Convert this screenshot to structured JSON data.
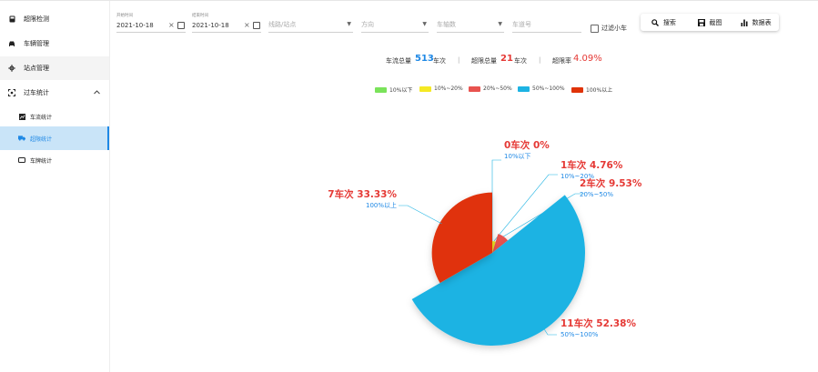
{
  "sidebar": {
    "items": [
      {
        "label": "超限检测",
        "icon": "device-icon"
      },
      {
        "label": "车辆管理",
        "icon": "car-icon"
      },
      {
        "label": "站点管理",
        "icon": "station-icon"
      },
      {
        "label": "过车统计",
        "icon": "stats-icon"
      }
    ],
    "subitems": [
      {
        "label": "车流统计",
        "icon": "flow-chart-icon"
      },
      {
        "label": "超限统计",
        "icon": "truck-icon"
      },
      {
        "label": "车牌统计",
        "icon": "plate-icon"
      }
    ]
  },
  "filters": {
    "start": {
      "label": "开始时间",
      "value": "2021-10-18"
    },
    "end": {
      "label": "结束时间",
      "value": "2021-10-18"
    },
    "route_placeholder": "线路/站点",
    "direction_placeholder": "方向",
    "axles_placeholder": "车轴数",
    "lane_placeholder": "车道号",
    "filter_small_label": "过滤小车"
  },
  "toolbar": {
    "search_label": "搜索",
    "screenshot_label": "截图",
    "datatable_label": "数据表"
  },
  "summary": {
    "flow_label": "车流总量",
    "flow_value": "513",
    "flow_unit": "车次",
    "over_label": "超限总量",
    "over_value": "21",
    "over_unit": "车次",
    "rate_label": "超限率",
    "rate_value": "4.09%",
    "sep": "|"
  },
  "colors": {
    "blue": "#1e88e5",
    "red": "#e53935"
  },
  "chart_data": {
    "type": "pie",
    "style": "rose",
    "legend_position": "top",
    "categories": [
      "10%以下",
      "10%~20%",
      "20%~50%",
      "50%~100%",
      "100%以上"
    ],
    "values": [
      0,
      1,
      2,
      11,
      7
    ],
    "percent_labels": [
      "0%",
      "4.76%",
      "9.53%",
      "52.38%",
      "33.33%"
    ],
    "value_labels": [
      "0车次",
      "1车次",
      "2车次",
      "11车次",
      "7车次"
    ],
    "colors": [
      "#7ae35a",
      "#f5e924",
      "#e8534f",
      "#1db3e3",
      "#e03308"
    ]
  }
}
